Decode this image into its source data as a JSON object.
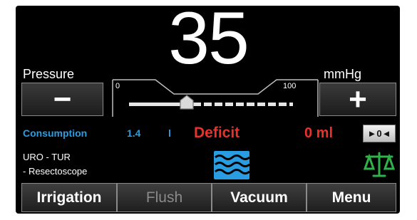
{
  "pressure": {
    "value": "35",
    "label": "Pressure",
    "unit": "mmHg",
    "minus_glyph": "−",
    "plus_glyph": "+",
    "slider": {
      "min_label": "0",
      "max_label": "100",
      "min": 0,
      "max": 100,
      "value": 35
    }
  },
  "consumption": {
    "label": "Consumption",
    "value": "1.4",
    "unit": "l"
  },
  "deficit": {
    "label": "Deficit",
    "value": "0 ml"
  },
  "zero_button": {
    "label": "►0◄"
  },
  "mode": {
    "line1": "URO - TUR",
    "line2": "- Resectoscope"
  },
  "icons": {
    "water": "water-waves-icon",
    "balance": "balance-scale-icon"
  },
  "menu": {
    "items": [
      {
        "label": "Irrigation",
        "enabled": true
      },
      {
        "label": "Flush",
        "enabled": false
      },
      {
        "label": "Vacuum",
        "enabled": true
      },
      {
        "label": "Menu",
        "enabled": true
      }
    ]
  },
  "colors": {
    "consumption": "#2a9de2",
    "deficit": "#e8322b",
    "water_icon": "#2a9de2",
    "balance_icon": "#2fb24a",
    "background": "#000000"
  }
}
